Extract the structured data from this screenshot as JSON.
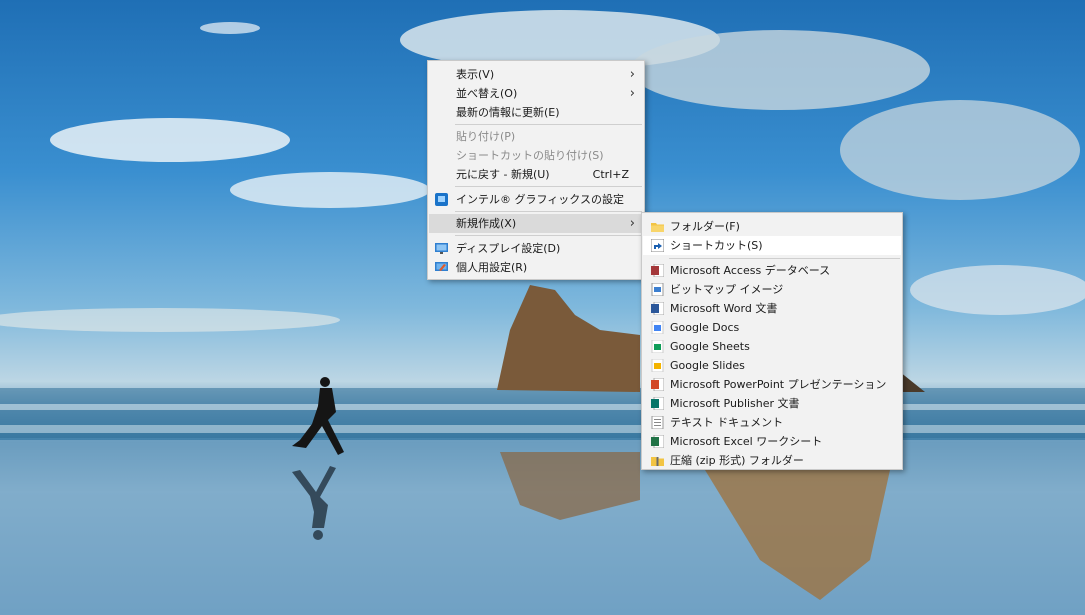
{
  "desktop": {
    "wallpaper": "beach-runner-sea-stack"
  },
  "context_menu": {
    "items": [
      {
        "label": "表示(V)",
        "submenu": true
      },
      {
        "label": "並べ替え(O)",
        "submenu": true
      },
      {
        "label": "最新の情報に更新(E)"
      },
      {
        "label": "貼り付け(P)",
        "disabled": true
      },
      {
        "label": "ショートカットの貼り付け(S)",
        "disabled": true
      },
      {
        "label": "元に戻す - 新規(U)",
        "shortcut": "Ctrl+Z"
      },
      {
        "label": "インテル® グラフィックスの設定",
        "icon": "intel-graphics-icon"
      },
      {
        "label": "新規作成(X)",
        "submenu": true,
        "highlighted": true
      },
      {
        "label": "ディスプレイ設定(D)",
        "icon": "display-settings-icon"
      },
      {
        "label": "個人用設定(R)",
        "icon": "personalize-icon"
      }
    ]
  },
  "new_submenu": {
    "items": [
      {
        "label": "フォルダー(F)",
        "icon": "folder-icon"
      },
      {
        "label": "ショートカット(S)",
        "icon": "shortcut-icon",
        "highlighted": true
      },
      {
        "label": "Microsoft Access データベース",
        "icon": "access-icon"
      },
      {
        "label": "ビットマップ イメージ",
        "icon": "bitmap-icon"
      },
      {
        "label": "Microsoft Word 文書",
        "icon": "word-icon"
      },
      {
        "label": "Google Docs",
        "icon": "google-docs-icon"
      },
      {
        "label": "Google Sheets",
        "icon": "google-sheets-icon"
      },
      {
        "label": "Google Slides",
        "icon": "google-slides-icon"
      },
      {
        "label": "Microsoft PowerPoint プレゼンテーション",
        "icon": "powerpoint-icon"
      },
      {
        "label": "Microsoft Publisher 文書",
        "icon": "publisher-icon"
      },
      {
        "label": "テキスト ドキュメント",
        "icon": "text-document-icon"
      },
      {
        "label": "Microsoft Excel ワークシート",
        "icon": "excel-icon"
      },
      {
        "label": "圧縮 (zip 形式) フォルダー",
        "icon": "zip-folder-icon"
      }
    ]
  }
}
